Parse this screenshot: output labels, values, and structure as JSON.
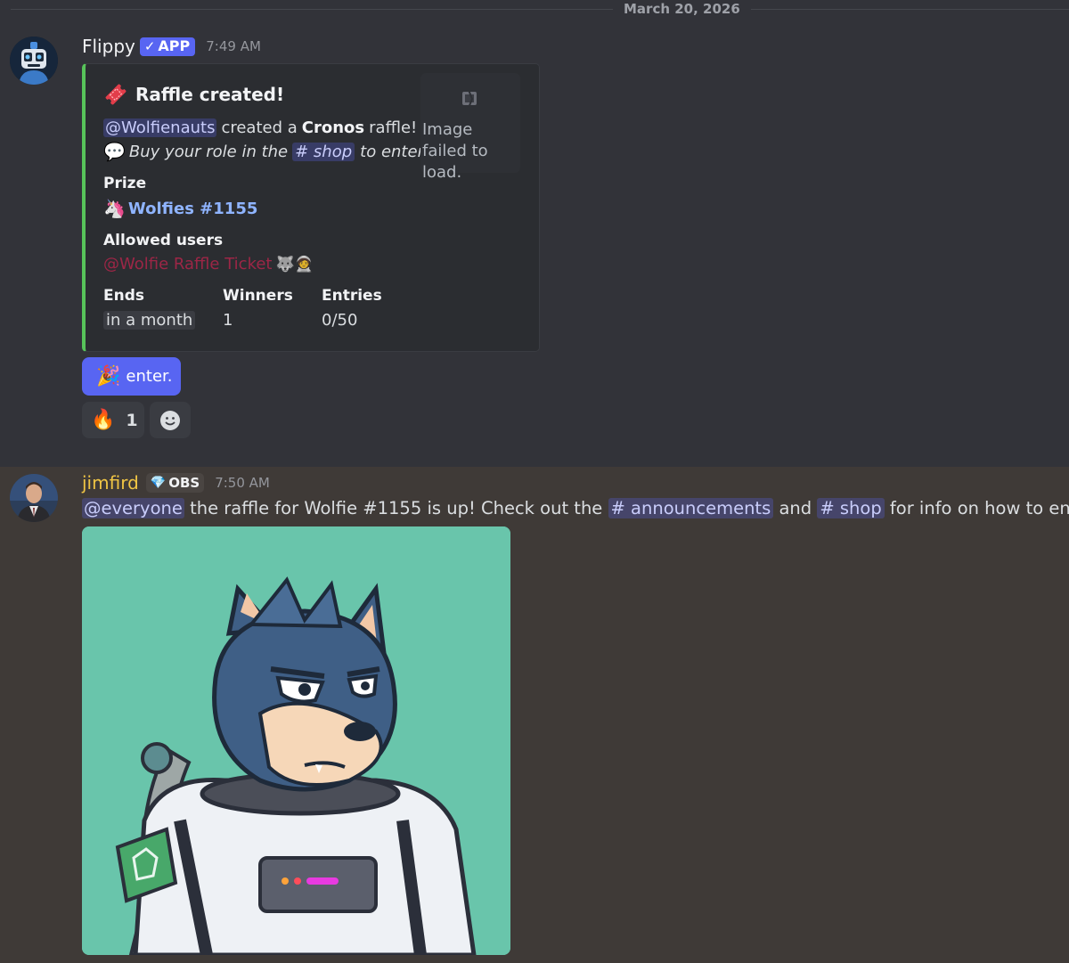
{
  "date_divider": "March 20, 2026",
  "message1": {
    "username": "Flippy",
    "app_tag": "APP",
    "timestamp": "7:49 AM",
    "embed": {
      "title": "Raffle created!",
      "mention_user": "@Wolfienauts",
      "line1_mid": "created a",
      "line1_bold": "Cronos",
      "line1_end": "raffle!",
      "line2_start": "Buy your role in the",
      "line2_channel": "# shop",
      "line2_end": "to enter!",
      "image_failed": "Image failed to load.",
      "prize_label": "Prize",
      "prize_value": "Wolfies #1155",
      "allowed_label": "Allowed users",
      "allowed_value": "@Wolfie Raffle Ticket",
      "ends_label": "Ends",
      "ends_value": "in a month",
      "winners_label": "Winners",
      "winners_value": "1",
      "entries_label": "Entries",
      "entries_value": "0/50",
      "accent_color": "#57c35a"
    },
    "button_label": "enter.",
    "reaction_count": "1"
  },
  "message2": {
    "username": "jimfird",
    "tag": "OBS",
    "timestamp": "7:50 AM",
    "mention": "@everyone",
    "text1": "the raffle for Wolfie #1155 is up! Check out the",
    "channel1": "# announcements",
    "text2": "and",
    "channel2": "# shop",
    "text3": "for info on how to enter!!"
  }
}
